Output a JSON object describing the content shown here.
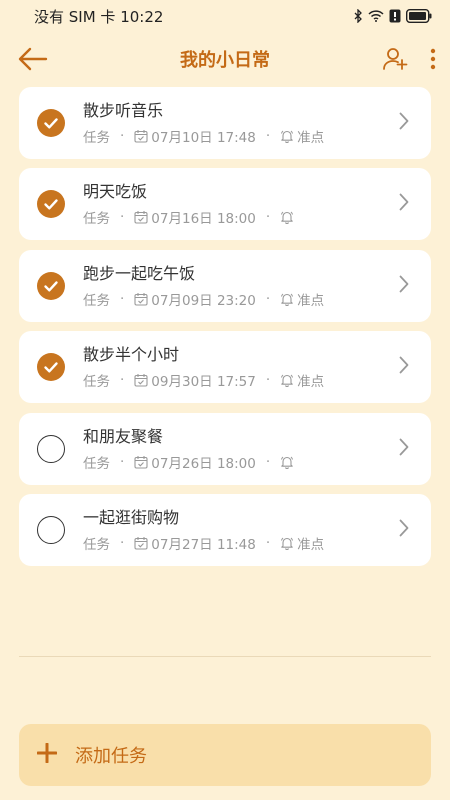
{
  "status_bar": {
    "carrier": "没有 SIM 卡",
    "time": "10:22"
  },
  "header": {
    "title": "我的小日常",
    "back_icon": "back-arrow-icon",
    "share_icon": "add-member-icon",
    "more_icon": "more-vertical-icon"
  },
  "colors": {
    "accent": "#c46a16",
    "background": "#fdf1d6",
    "card": "#ffffff",
    "add_bar": "#f9dfaa"
  },
  "tasks": [
    {
      "title": "散步听音乐",
      "type": "任务",
      "date": "07月10日 17:48",
      "reminder": "准点",
      "done": true
    },
    {
      "title": "明天吃饭",
      "type": "任务",
      "date": "07月16日 18:00",
      "reminder": "",
      "done": true
    },
    {
      "title": "跑步一起吃午饭",
      "type": "任务",
      "date": "07月09日 23:20",
      "reminder": "准点",
      "done": true
    },
    {
      "title": "散步半个小时",
      "type": "任务",
      "date": "09月30日 17:57",
      "reminder": "准点",
      "done": true
    },
    {
      "title": "和朋友聚餐",
      "type": "任务",
      "date": "07月26日 18:00",
      "reminder": "",
      "done": false
    },
    {
      "title": "一起逛街购物",
      "type": "任务",
      "date": "07月27日 11:48",
      "reminder": "准点",
      "done": false
    }
  ],
  "footer": {
    "add_label": "添加任务"
  }
}
